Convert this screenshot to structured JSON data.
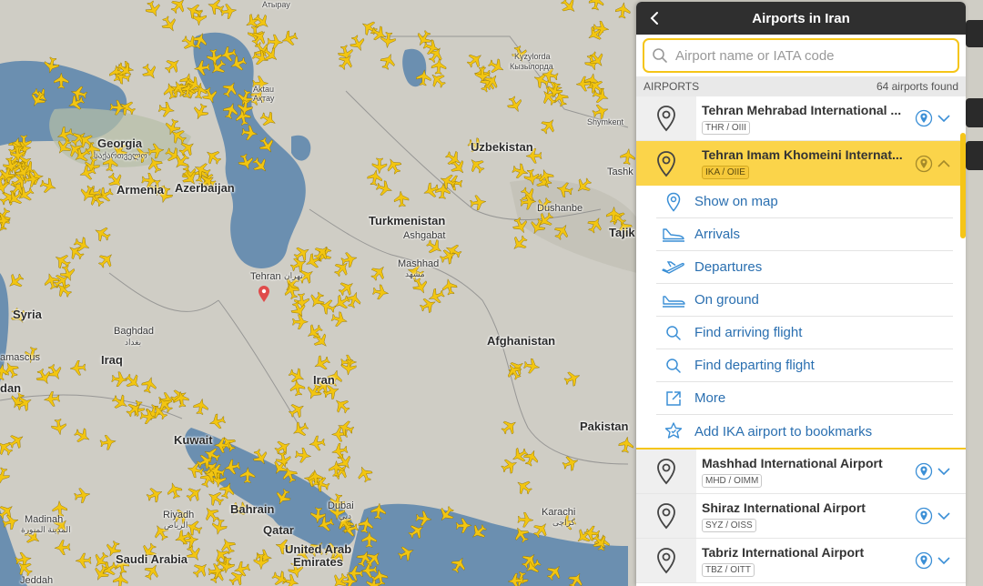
{
  "panel": {
    "title": "Airports in Iran",
    "search_placeholder": "Airport name or IATA code",
    "section_label": "AIRPORTS",
    "count_text": "64 airports found"
  },
  "airports": [
    {
      "name": "Tehran Mehrabad International ...",
      "code": "THR / OIII",
      "active": false
    },
    {
      "name": "Tehran Imam Khomeini Internat...",
      "code": "IKA / OIIE",
      "active": true
    },
    {
      "name": "Mashhad International Airport",
      "code": "MHD / OIMM",
      "active": false
    },
    {
      "name": "Shiraz International Airport",
      "code": "SYZ / OISS",
      "active": false
    },
    {
      "name": "Tabriz International Airport",
      "code": "TBZ / OITT",
      "active": false
    }
  ],
  "submenu": [
    {
      "label": "Show on map",
      "icon": "map-pin-icon"
    },
    {
      "label": "Arrivals",
      "icon": "arrivals-icon"
    },
    {
      "label": "Departures",
      "icon": "departures-icon"
    },
    {
      "label": "On ground",
      "icon": "on-ground-icon"
    },
    {
      "label": "Find arriving flight",
      "icon": "search-icon"
    },
    {
      "label": "Find departing flight",
      "icon": "search-icon"
    },
    {
      "label": "More",
      "icon": "external-link-icon"
    },
    {
      "label": "Add IKA airport to bookmarks",
      "icon": "bookmark-icon"
    }
  ],
  "map_labels": {
    "georgia": "Georgia",
    "georgia_native": "საქართველო",
    "armenia": "Armenia",
    "azerbaijan": "Azerbaijan",
    "turkmenistan": "Turkmenistan",
    "ashgabat": "Ashgabat",
    "uzbekistan": "Uzbekistan",
    "kyzylorda": "Kyzylorda",
    "kyzylorda_native": "Кызылорда",
    "aktau": "Aktau",
    "aktau_native": "Ақтау",
    "tehran": "Tehran",
    "tehran_native": "تهران",
    "mashhad": "Mashhad",
    "mashhad_native": "مشهد",
    "syria": "Syria",
    "baghdad": "Baghdad",
    "baghdad_native": "بغداد",
    "iraq": "Iraq",
    "damascus": "amascus",
    "jordan": "dan",
    "iran": "Iran",
    "afghanistan": "Afghanistan",
    "kuwait": "Kuwait",
    "pakistan": "Pakistan",
    "karachi": "Karachi",
    "karachi_native": "كراچی",
    "bahrain": "Bahrain",
    "qatar": "Qatar",
    "uae_1": "United Arab",
    "uae_2": "Emirates",
    "dubai": "Dubai",
    "dubai_native": "دبي",
    "riyadh": "Riyadh",
    "riyadh_native": "الرياض",
    "medina": "Madinah",
    "medina_native": "المدينة المنورة",
    "saudi": "Saudi Arabia",
    "jeddah": "Jeddah",
    "dushanbe": "Dushanbe",
    "tashkent": "Tashk",
    "shymkent": "Shymkent",
    "tajik": "Tajik",
    "atyrau": "Атырау"
  },
  "colors": {
    "accent": "#f5c518",
    "header_bg": "#2f2f2f",
    "link": "#2a6fb0",
    "plane": "#f2c511"
  }
}
